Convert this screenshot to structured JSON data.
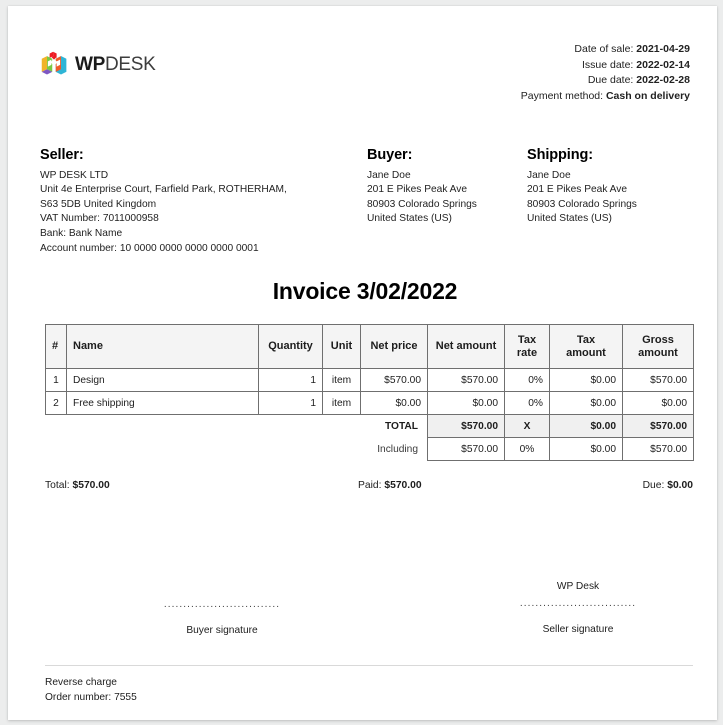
{
  "brand": {
    "logo_icon": "wpdesk-cube-logo",
    "name_bold": "WP",
    "name_light": "DESK"
  },
  "meta": {
    "date_of_sale_label": "Date of sale:",
    "date_of_sale_value": "2021-04-29",
    "issue_date_label": "Issue date:",
    "issue_date_value": "2022-02-14",
    "due_date_label": "Due date:",
    "due_date_value": "2022-02-28",
    "payment_method_label": "Payment method:",
    "payment_method_value": "Cash on delivery"
  },
  "seller": {
    "heading": "Seller:",
    "company": "WP DESK LTD",
    "address": "Unit 4e Enterprise Court, Farfield Park, ROTHERHAM,\nS63 5DB United Kingdom",
    "vat": "VAT Number: 7011000958",
    "bank": "Bank: Bank Name",
    "account": "Account number: 10 0000 0000 0000 0000 0001"
  },
  "buyer": {
    "heading": "Buyer:",
    "name": "Jane Doe",
    "street": "201 E Pikes Peak Ave",
    "city": "80903 Colorado Springs",
    "country": "United States (US)"
  },
  "shipping": {
    "heading": "Shipping:",
    "name": "Jane Doe",
    "street": "201 E Pikes Peak Ave",
    "city": "80903 Colorado Springs",
    "country": "United States (US)"
  },
  "document": {
    "title": "Invoice 3/02/2022"
  },
  "table": {
    "columns": [
      "#",
      "Name",
      "Quantity",
      "Unit",
      "Net price",
      "Net amount",
      "Tax rate",
      "Tax amount",
      "Gross amount"
    ],
    "rows": [
      {
        "index": "1",
        "name": "Design",
        "quantity": "1",
        "unit": "item",
        "net_price": "$570.00",
        "net_amount": "$570.00",
        "tax_rate": "0%",
        "tax_amount": "$0.00",
        "gross_amount": "$570.00"
      },
      {
        "index": "2",
        "name": "Free shipping",
        "quantity": "1",
        "unit": "item",
        "net_price": "$0.00",
        "net_amount": "$0.00",
        "tax_rate": "0%",
        "tax_amount": "$0.00",
        "gross_amount": "$0.00"
      }
    ],
    "total_row": {
      "label": "TOTAL",
      "net_amount": "$570.00",
      "tax_rate": "X",
      "tax_amount": "$0.00",
      "gross_amount": "$570.00"
    },
    "including_row": {
      "label": "Including",
      "net_amount": "$570.00",
      "tax_rate": "0%",
      "tax_amount": "$0.00",
      "gross_amount": "$570.00"
    }
  },
  "totals": {
    "total_label": "Total:",
    "total_value": "$570.00",
    "paid_label": "Paid:",
    "paid_value": "$570.00",
    "due_label": "Due:",
    "due_value": "$0.00"
  },
  "signatures": {
    "dots": "..............................",
    "buyer_caption": "Buyer signature",
    "seller_name": "WP Desk",
    "seller_caption": "Seller signature"
  },
  "footer": {
    "reverse_charge": "Reverse charge",
    "order_number": "Order number: 7555"
  }
}
